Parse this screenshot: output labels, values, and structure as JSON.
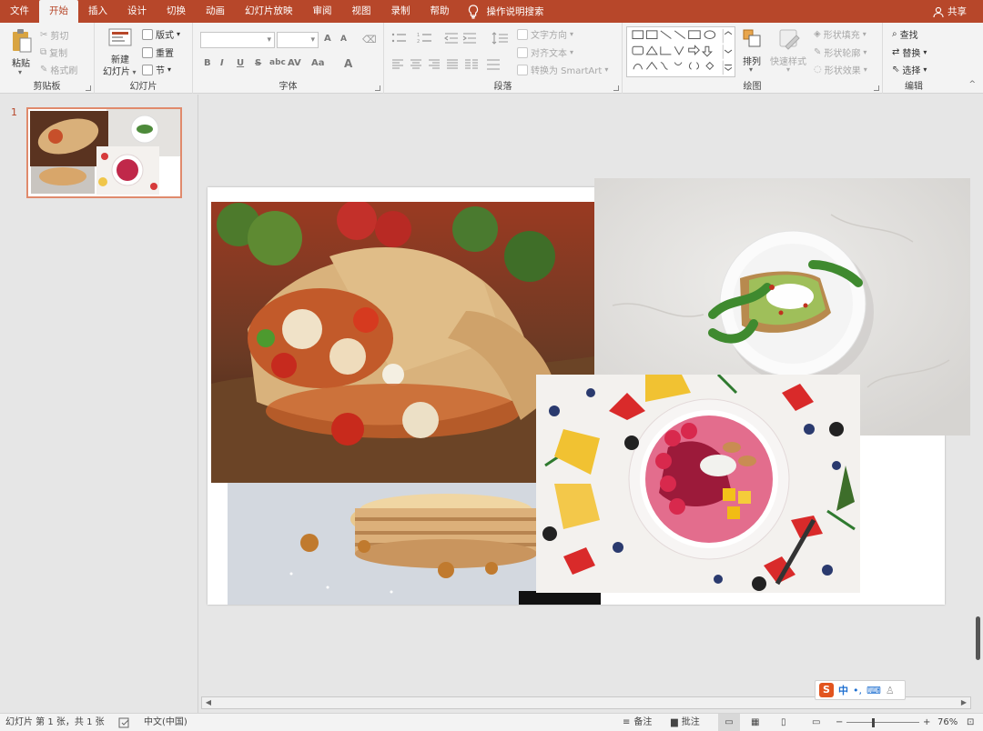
{
  "tabs": [
    {
      "label": "文件",
      "active": false
    },
    {
      "label": "开始",
      "active": true
    },
    {
      "label": "插入",
      "active": false
    },
    {
      "label": "设计",
      "active": false
    },
    {
      "label": "切换",
      "active": false
    },
    {
      "label": "动画",
      "active": false
    },
    {
      "label": "幻灯片放映",
      "active": false
    },
    {
      "label": "审阅",
      "active": false
    },
    {
      "label": "视图",
      "active": false
    },
    {
      "label": "录制",
      "active": false
    },
    {
      "label": "帮助",
      "active": false
    }
  ],
  "tell_me": "操作说明搜索",
  "share": "共享",
  "ribbon": {
    "clipboard": {
      "paste": "粘贴",
      "cut": "剪切",
      "copy": "复制",
      "format_painter": "格式刷",
      "label": "剪贴板"
    },
    "slides": {
      "new_slide_line1": "新建",
      "new_slide_line2": "幻灯片",
      "layout": "版式",
      "reset": "重置",
      "section": "节",
      "label": "幻灯片"
    },
    "font": {
      "bold": "B",
      "italic": "I",
      "underline": "U",
      "strike": "S",
      "shadow": "abc",
      "spacing": "AV",
      "case": "Aa",
      "color": "A",
      "grow": "A",
      "shrink": "A",
      "label": "字体"
    },
    "paragraph": {
      "text_direction": "文字方向",
      "align_text": "对齐文本",
      "smartart": "转换为 SmartArt",
      "label": "段落"
    },
    "drawing": {
      "arrange": "排列",
      "quick_styles": "快速样式",
      "shape_fill": "形状填充",
      "shape_outline": "形状轮廓",
      "shape_effects": "形状效果",
      "label": "绘图"
    },
    "editing": {
      "find": "查找",
      "replace": "替换",
      "select": "选择",
      "label": "编辑"
    }
  },
  "slide_number": "1",
  "ime": {
    "mode": "中"
  },
  "status": {
    "slide_info": "幻灯片 第 1 张，共 1 张",
    "language": "中文(中国)",
    "notes": "备注",
    "comments": "批注",
    "zoom": "76%"
  },
  "colors": {
    "accent": "#b7472a"
  }
}
